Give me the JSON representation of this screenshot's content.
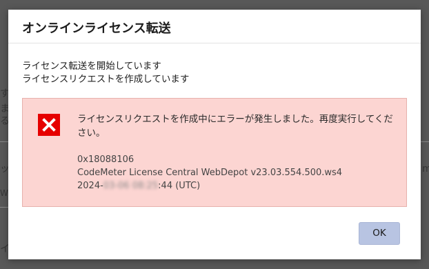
{
  "background": {
    "left_fragments": [
      "す",
      "ま",
      "る",
      "ッ",
      "W",
      "イ"
    ],
    "right_fragments": [
      "m"
    ]
  },
  "dialog": {
    "title": "オンラインライセンス転送",
    "status_lines": [
      "ライセンス転送を開始しています",
      "ライセンスリクエストを作成しています"
    ],
    "error": {
      "icon": "error-x-icon",
      "message": "ライセンスリクエストを作成中にエラーが発生しました。再度実行してください。",
      "code": "0x18088106",
      "product": "CodeMeter License Central WebDepot v23.03.554.500.ws4",
      "timestamp_prefix": "2024-",
      "timestamp_blurred_1": "03-06 08:",
      "timestamp_blurred_2": "25",
      "timestamp_suffix": ":44 (UTC)"
    },
    "ok_label": "OK"
  },
  "colors": {
    "overlay": "#585858",
    "error_bg": "#fcd5d2",
    "error_border": "#e7b1ac",
    "error_icon": "#e60000",
    "ok_button": "#b8c4e2"
  }
}
